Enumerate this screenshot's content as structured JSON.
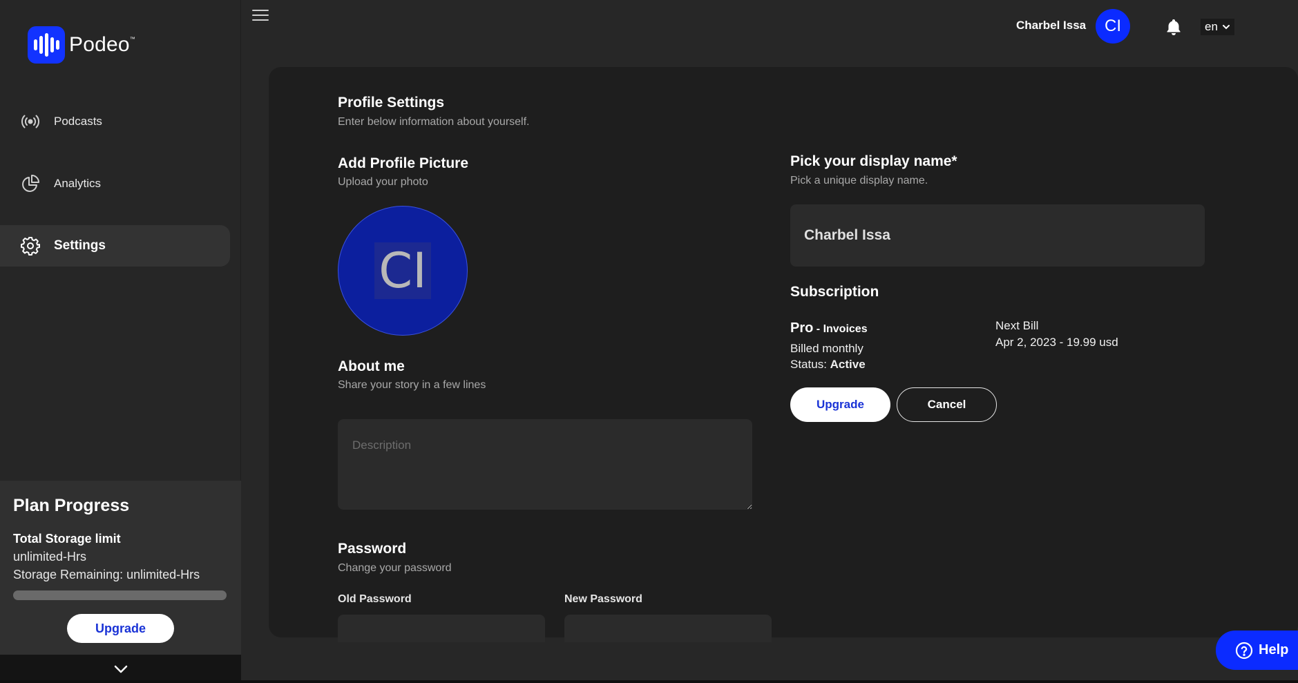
{
  "brand": {
    "name": "Podeo",
    "tm": "™",
    "color": "#1233ff"
  },
  "sidebar": {
    "items": [
      {
        "label": "Podcasts",
        "icon": "broadcast-icon",
        "active": false
      },
      {
        "label": "Analytics",
        "icon": "pie-chart-icon",
        "active": false
      },
      {
        "label": "Settings",
        "icon": "gear-icon",
        "active": true
      }
    ],
    "plan": {
      "title": "Plan Progress",
      "storage_label": "Total Storage limit",
      "storage_value": "unlimited-Hrs",
      "remaining": "Storage Remaining: unlimited-Hrs",
      "upgrade_label": "Upgrade"
    }
  },
  "header": {
    "user_name": "Charbel Issa",
    "avatar_initials": "CI",
    "language": "en"
  },
  "profile": {
    "title": "Profile Settings",
    "subtitle": "Enter below information about yourself.",
    "picture_title": "Add Profile Picture",
    "picture_subtitle": "Upload your photo",
    "picture_initials": "CI",
    "about_title": "About me",
    "about_subtitle": "Share your story in a few lines",
    "description_placeholder": "Description",
    "password_title": "Password",
    "password_subtitle": "Change your password",
    "old_password_label": "Old Password",
    "new_password_label": "New Password"
  },
  "display_name": {
    "title": "Pick your display name*",
    "subtitle": "Pick a unique display name.",
    "value": "Charbel Issa"
  },
  "subscription": {
    "title": "Subscription",
    "plan": "Pro",
    "invoices": " - Invoices",
    "billing": "Billed monthly",
    "status_label": "Status: ",
    "status_value": "Active",
    "next_bill_label": "Next Bill",
    "next_bill_value": "Apr 2, 2023 - 19.99 usd",
    "upgrade_label": "Upgrade",
    "cancel_label": "Cancel"
  },
  "help": {
    "label": "Help"
  }
}
